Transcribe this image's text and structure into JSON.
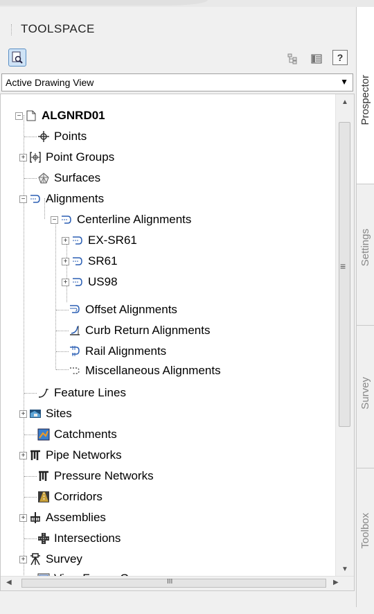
{
  "panel": {
    "title": "TOOLSPACE",
    "dropdown_value": "Active Drawing View",
    "help_label": "?"
  },
  "side_tabs": [
    "Prospector",
    "Settings",
    "Survey",
    "Toolbox"
  ],
  "tree": {
    "root": "ALGNRD01",
    "items": {
      "points": "Points",
      "point_groups": "Point Groups",
      "surfaces": "Surfaces",
      "alignments": "Alignments",
      "centerline_alignments": "Centerline Alignments",
      "ex_sr61": "EX-SR61",
      "sr61": "SR61",
      "us98": "US98",
      "offset_alignments": "Offset Alignments",
      "curb_return_alignments": "Curb Return Alignments",
      "rail_alignments": "Rail Alignments",
      "misc_alignments": "Miscellaneous Alignments",
      "feature_lines": "Feature Lines",
      "sites": "Sites",
      "catchments": "Catchments",
      "pipe_networks": "Pipe Networks",
      "pressure_networks": "Pressure Networks",
      "corridors": "Corridors",
      "assemblies": "Assemblies",
      "intersections": "Intersections",
      "survey": "Survey",
      "view_frame_groups": "View Frame Groups"
    }
  },
  "scroll": {
    "v_grip": "≡",
    "h_grip": "III"
  }
}
